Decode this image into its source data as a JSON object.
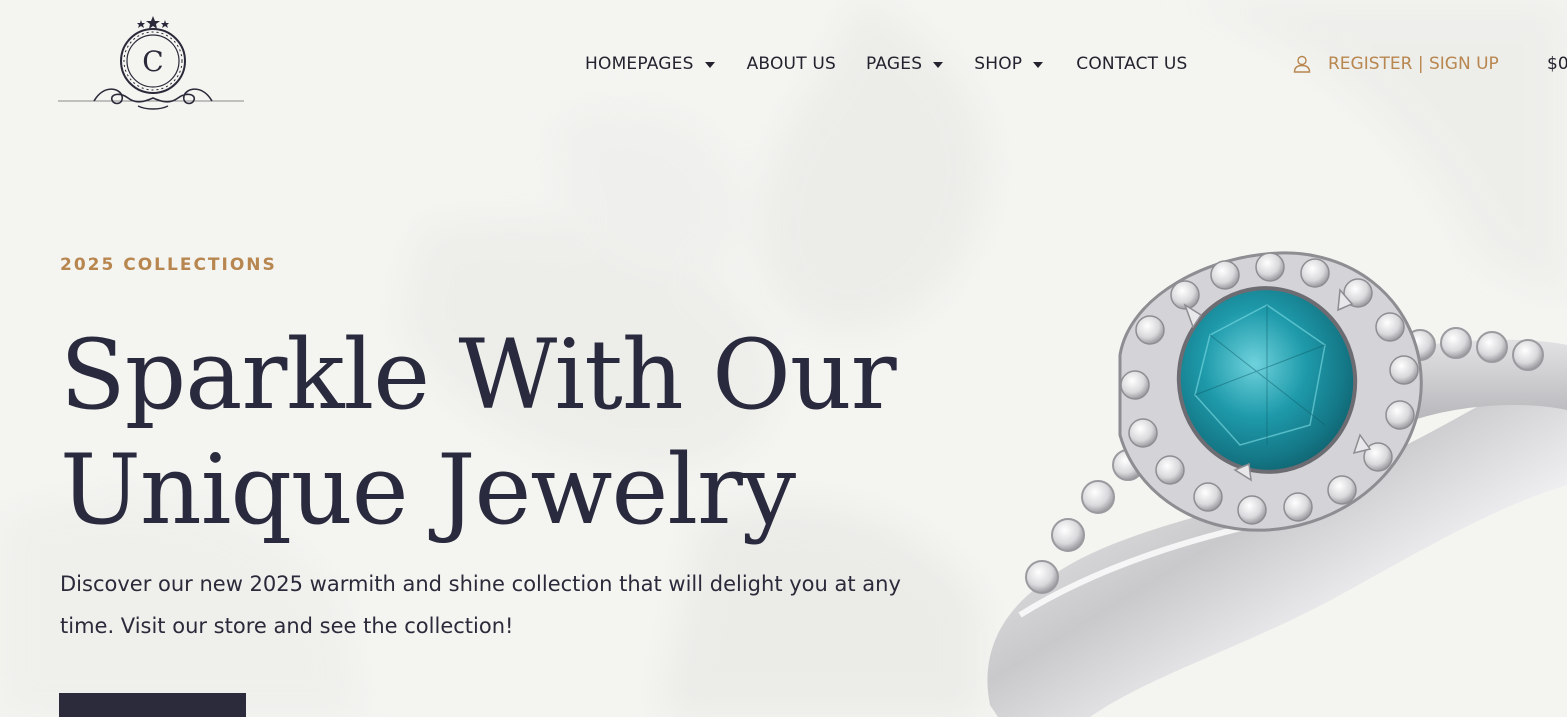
{
  "header": {
    "logo_letter": "C",
    "nav": [
      {
        "label": "HOMEPAGES",
        "has_dropdown": true
      },
      {
        "label": "ABOUT US",
        "has_dropdown": false
      },
      {
        "label": "PAGES",
        "has_dropdown": true
      },
      {
        "label": "SHOP",
        "has_dropdown": true
      },
      {
        "label": "CONTACT US",
        "has_dropdown": false
      }
    ],
    "account_label": "REGISTER | SIGN UP",
    "cart_amount": "$0"
  },
  "hero": {
    "eyebrow": "2025 COLLECTIONS",
    "headline_line1": "Sparkle With Our",
    "headline_line2": "Unique Jewelry",
    "description": "Discover our new 2025 warmith and shine collection that will delight you at any time. Visit our store and see the collection!",
    "cta_label": ""
  },
  "colors": {
    "background": "#f4f4f1",
    "accent_gold": "#b8864f",
    "text_dark": "#2a2a3e",
    "button_dark": "#2c2b3c",
    "gem_teal": "#1e9aaa"
  },
  "icons": {
    "account": "user-icon",
    "dropdown": "caret-down-icon"
  }
}
